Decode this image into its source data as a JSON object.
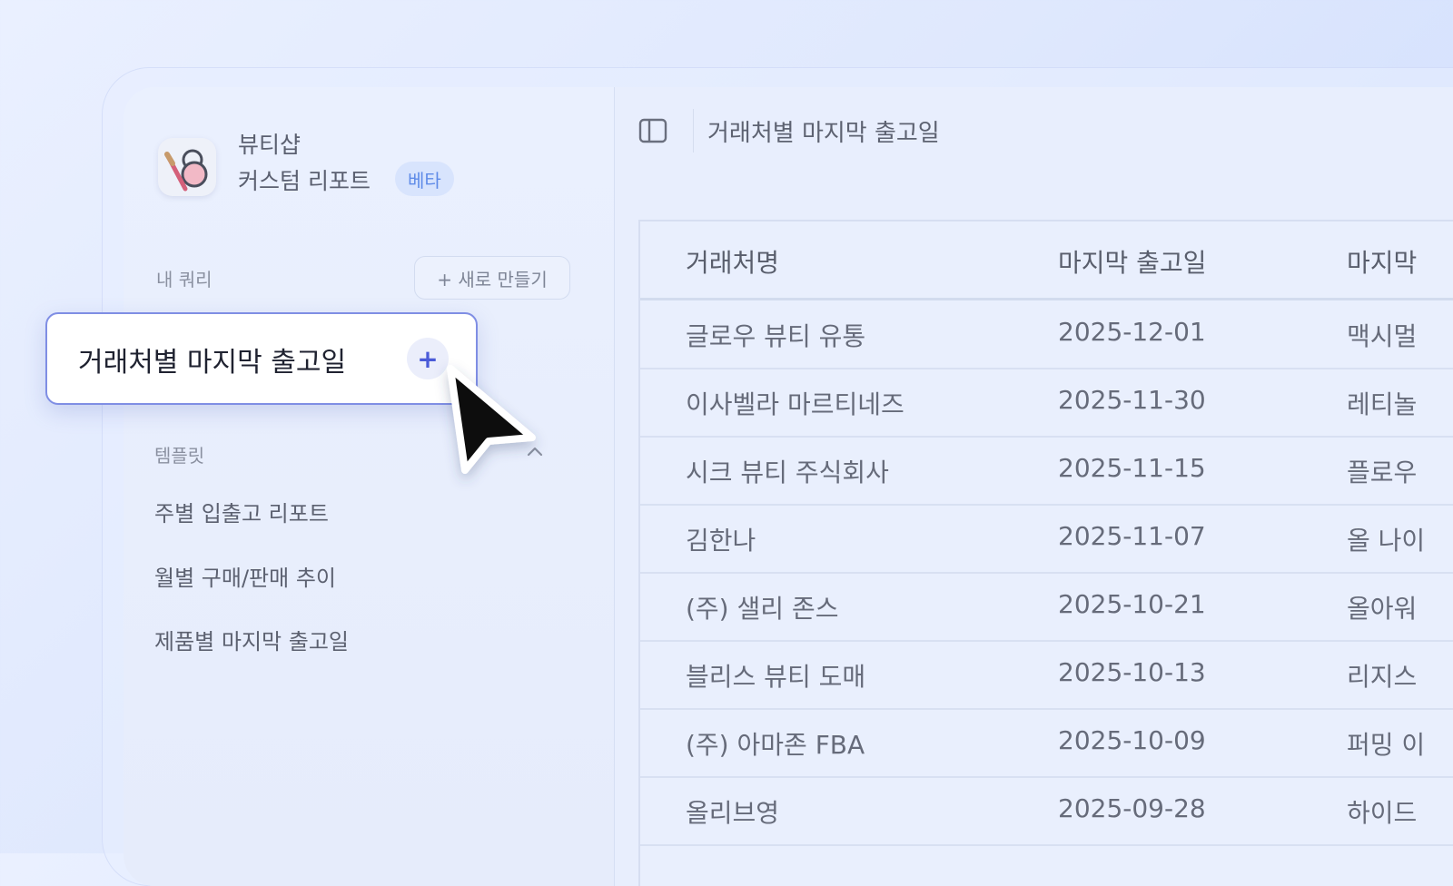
{
  "app": {
    "name": "뷰티샵",
    "subtitle": "커스텀 리포트",
    "badge": "베타"
  },
  "sidebar": {
    "my_queries_label": "내 쿼리",
    "new_button_label": "+ 새로 만들기",
    "active_query": {
      "label": "거래처별 마지막 출고일",
      "add_symbol": "+"
    },
    "templates_label": "템플릿",
    "templates": [
      {
        "label": "주별 입출고 리포트"
      },
      {
        "label": "월별 구매/판매 추이"
      },
      {
        "label": "제품별 마지막 출고일"
      }
    ]
  },
  "main": {
    "title": "거래처별 마지막 출고일",
    "table": {
      "headers": [
        "거래처명",
        "마지막 출고일",
        "마지막"
      ],
      "rows": [
        [
          "글로우 뷰티 유통",
          "2025-12-01",
          "맥시멀"
        ],
        [
          "이사벨라 마르티네즈",
          "2025-11-30",
          "레티놀"
        ],
        [
          "시크 뷰티 주식회사",
          "2025-11-15",
          "플로우"
        ],
        [
          "김한나",
          "2025-11-07",
          "올 나이"
        ],
        [
          "(주) 샐리 존스",
          "2025-10-21",
          "올아워"
        ],
        [
          "블리스 뷰티 도매",
          "2025-10-13",
          "리지스"
        ],
        [
          "(주) 아마존 FBA",
          "2025-10-09",
          "퍼밍 이"
        ],
        [
          "올리브영",
          "2025-09-28",
          "하이드"
        ]
      ]
    }
  },
  "colors": {
    "accent": "#4a5bd8",
    "card_border": "#7f8ee4",
    "badge_bg": "#d8e4fd",
    "badge_text": "#5f8be8"
  }
}
